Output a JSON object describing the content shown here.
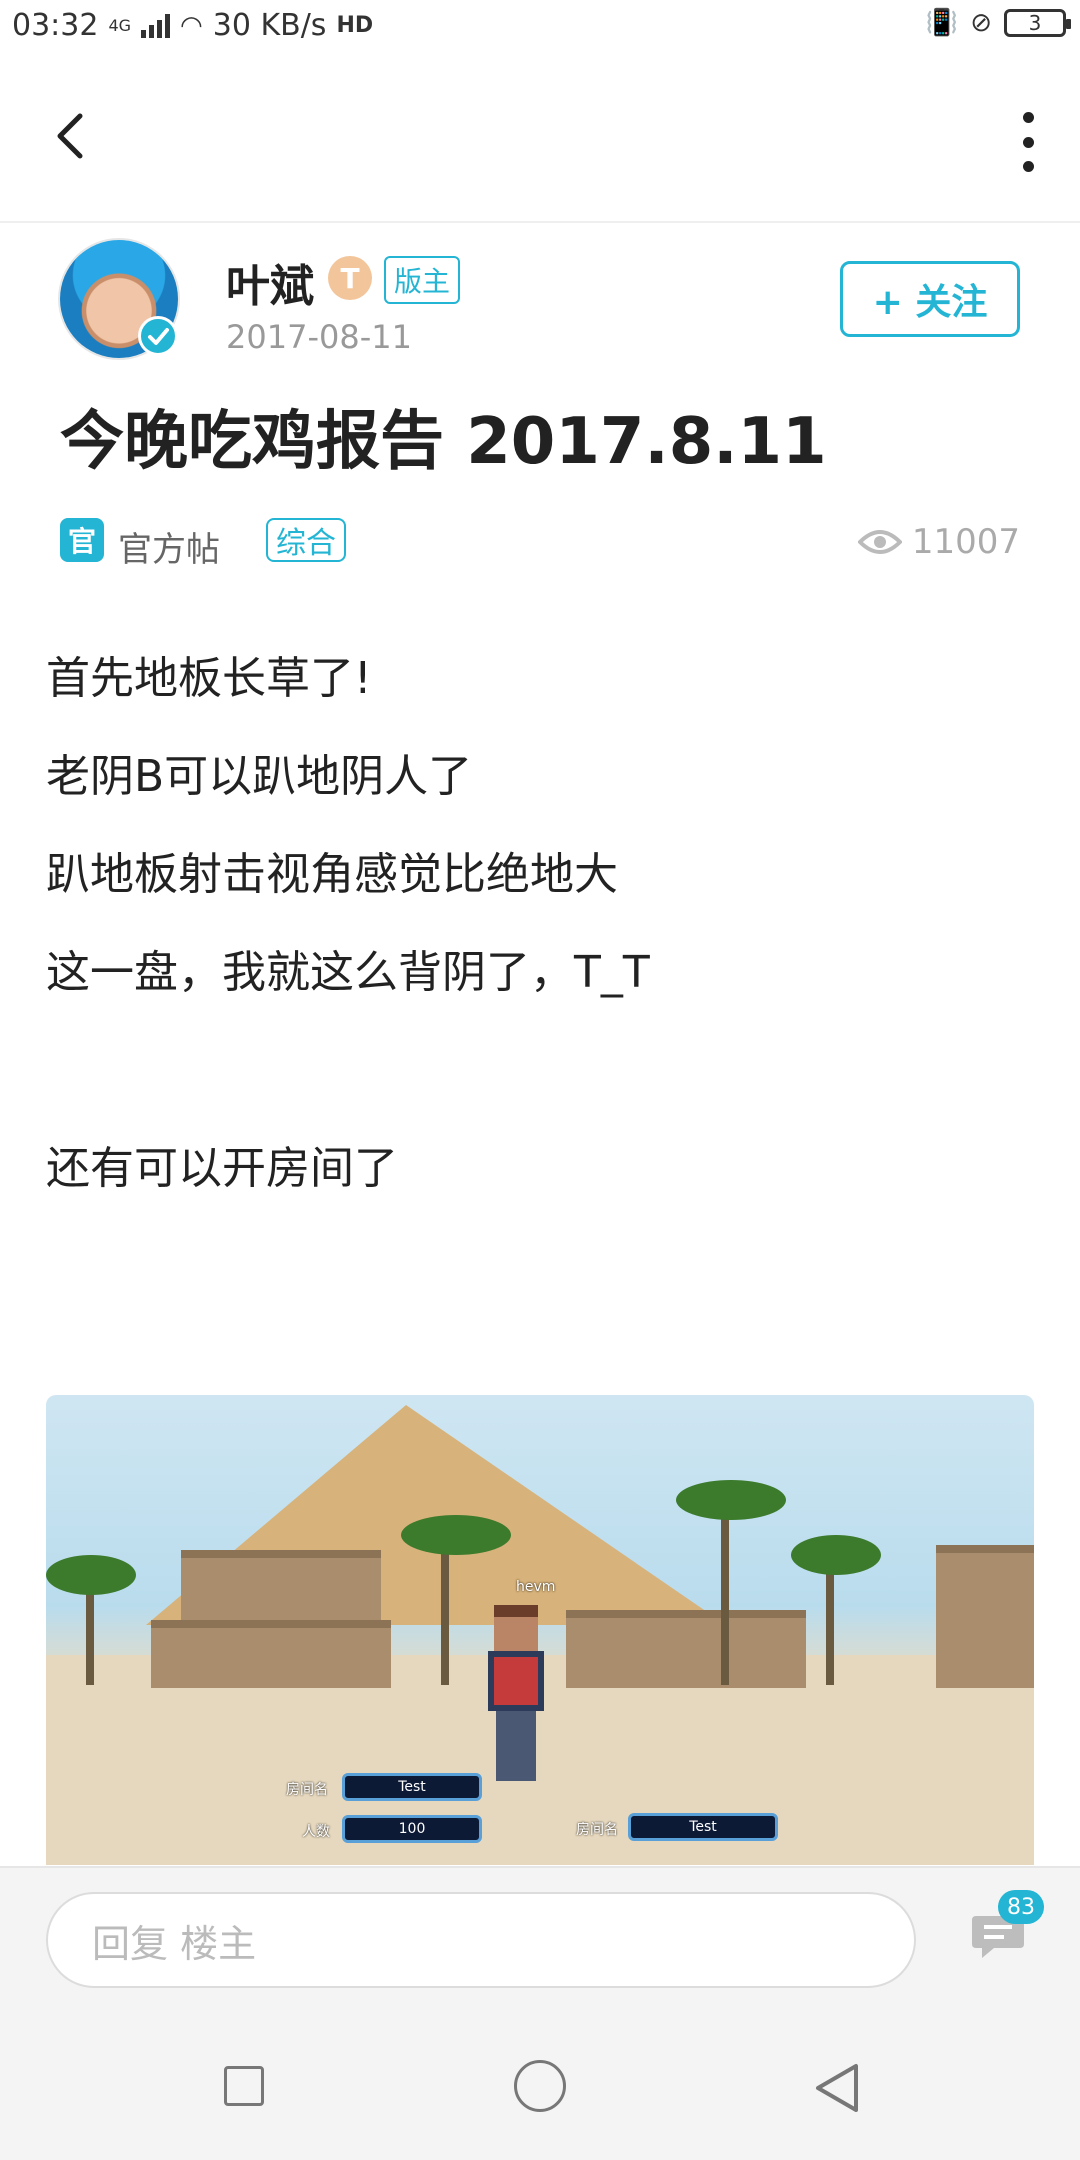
{
  "status_bar": {
    "time": "03:32",
    "network": "4G",
    "speed": "30 KB/s",
    "hd": "HD",
    "battery": "3"
  },
  "header": {
    "back_icon": "chevron-left-icon",
    "more_icon": "more-vertical-icon"
  },
  "author": {
    "name": "叶斌",
    "level_badge": "T",
    "role": "版主",
    "date": "2017-08-11",
    "follow_label": "+ 关注"
  },
  "post": {
    "title": "今晚吃鸡报告 2017.8.11",
    "official_icon": "官",
    "official_label": "官方帖",
    "category": "综合",
    "views": "11007",
    "paragraphs": [
      "首先地板长草了!",
      "老阴B可以趴地阴人了",
      "趴地板射击视角感觉比绝地大",
      "这一盘，我就这么背阴了，T_T",
      "",
      "还有可以开房间了"
    ],
    "image": {
      "player_tag": "hevm",
      "room_name_label_left": "房间名",
      "room_name_value_left": "Test",
      "people_label": "人数",
      "people_value": "100",
      "room_name_label_right": "房间名",
      "room_name_value_right": "Test"
    }
  },
  "reply_bar": {
    "placeholder": "回复  楼主",
    "comment_count": "83"
  },
  "colors": {
    "accent": "#23b5d3",
    "text": "#222222",
    "muted": "#999999"
  }
}
